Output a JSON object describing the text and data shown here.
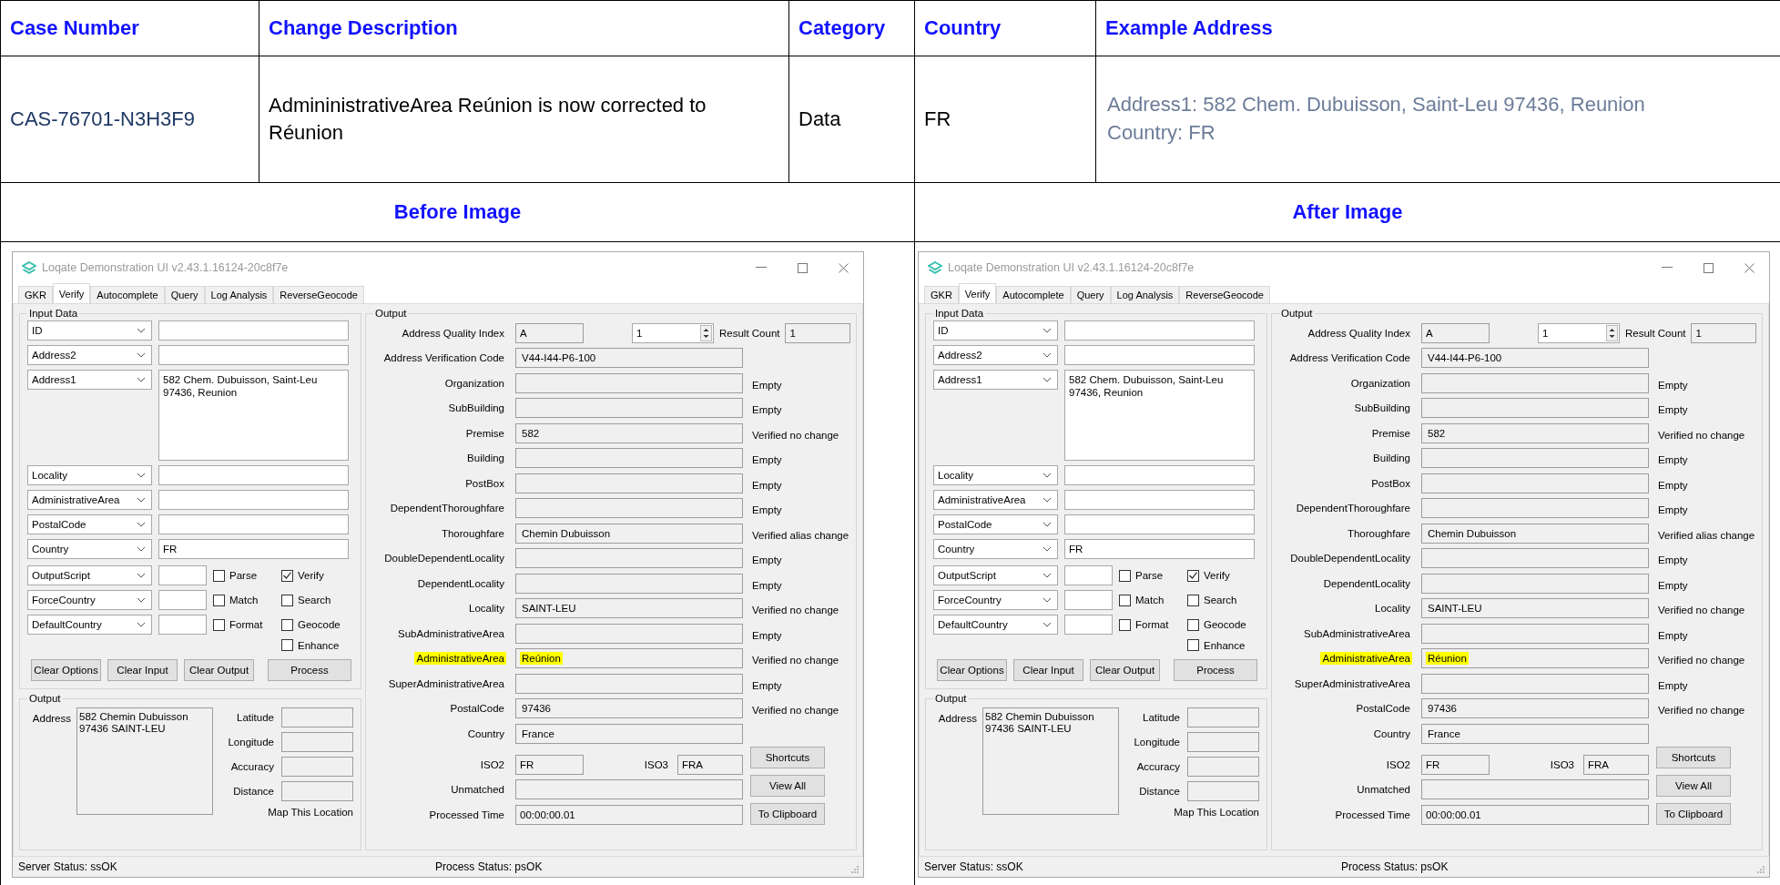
{
  "table": {
    "columns": [
      "Case Number",
      "Change Description",
      "Category",
      "Country",
      "Example Address"
    ],
    "row": {
      "case_number": "CAS-76701-N3H3F9",
      "change_description": "AdmininistrativeArea Reúnion is now corrected to Réunion",
      "category": "Data",
      "country": "FR",
      "example_address": [
        "Address1: 582 Chem. Dubuisson, Saint-Leu 97436, Reunion",
        "Country: FR"
      ]
    }
  },
  "comparison": [
    {
      "heading": "Before Image",
      "window": {
        "title": "Loqate Demonstration UI v2.43.1.16124-20c8f7e",
        "tabs": [
          {
            "label": "GKR",
            "selected": false
          },
          {
            "label": "Verify",
            "selected": true
          },
          {
            "label": "Autocomplete",
            "selected": false
          },
          {
            "label": "Query",
            "selected": false
          },
          {
            "label": "Log Analysis",
            "selected": false
          },
          {
            "label": "ReverseGeocode",
            "selected": false
          }
        ],
        "input_data": {
          "title": "Input Data",
          "rows": [
            {
              "kind": "line",
              "combo": "ID"
            },
            {
              "kind": "line",
              "combo": "Address2"
            },
            {
              "kind": "area",
              "combo": "Address1",
              "value": "582 Chem. Dubuisson, Saint-Leu 97436, Reunion"
            },
            {
              "kind": "line",
              "combo": "Locality"
            },
            {
              "kind": "line",
              "combo": "AdministrativeArea"
            },
            {
              "kind": "line",
              "combo": "PostalCode"
            },
            {
              "kind": "line",
              "combo": "Country",
              "value": "FR"
            }
          ],
          "option_combos": [
            "OutputScript",
            "ForceCountry",
            "DefaultCountry"
          ],
          "options": [
            [
              {
                "label": "Parse",
                "checked": false
              },
              {
                "label": "Match",
                "checked": false
              },
              {
                "label": "Format",
                "checked": false
              }
            ],
            [
              {
                "label": "Verify",
                "checked": true
              },
              {
                "label": "Search",
                "checked": false
              },
              {
                "label": "Geocode",
                "checked": false
              },
              {
                "label": "Enhance",
                "checked": false
              }
            ]
          ],
          "buttons": [
            "Clear Options",
            "Clear Input",
            "Clear Output",
            "Process"
          ]
        },
        "address_output": {
          "title": "Output",
          "address_label": "Address",
          "address_lines": [
            "582 Chemin Dubuisson",
            "97436 SAINT-LEU"
          ],
          "coords": [
            "Latitude",
            "Longitude",
            "Accuracy",
            "Distance"
          ],
          "link": "Map This Location"
        },
        "output": {
          "title": "Output",
          "quality": {
            "label": "Address Quality Index",
            "value": "A"
          },
          "spinner": "1",
          "result_count": {
            "label": "Result Count",
            "value": "1"
          },
          "rows": [
            {
              "label": "Address Verification Code",
              "value": "V44-I44-P6-100",
              "highlighted": false
            },
            {
              "label": "Organization",
              "status": "Empty",
              "highlighted": false
            },
            {
              "label": "SubBuilding",
              "status": "Empty",
              "highlighted": false
            },
            {
              "label": "Premise",
              "value": "582",
              "status": "Verified no change",
              "highlighted": false
            },
            {
              "label": "Building",
              "status": "Empty",
              "highlighted": false
            },
            {
              "label": "PostBox",
              "status": "Empty",
              "highlighted": false
            },
            {
              "label": "DependentThoroughfare",
              "status": "Empty",
              "highlighted": false
            },
            {
              "label": "Thoroughfare",
              "value": "Chemin Dubuisson",
              "status": "Verified alias change",
              "highlighted": false
            },
            {
              "label": "DoubleDependentLocality",
              "status": "Empty",
              "highlighted": false
            },
            {
              "label": "DependentLocality",
              "status": "Empty",
              "highlighted": false
            },
            {
              "label": "Locality",
              "value": "SAINT-LEU",
              "status": "Verified no change",
              "highlighted": false
            },
            {
              "label": "SubAdministrativeArea",
              "status": "Empty",
              "highlighted": false
            },
            {
              "label": "AdministrativeArea",
              "value": "Reúnion",
              "status": "Verified no change",
              "highlighted": true
            },
            {
              "label": "SuperAdministrativeArea",
              "status": "Empty",
              "highlighted": false
            },
            {
              "label": "PostalCode",
              "value": "97436",
              "status": "Verified no change",
              "highlighted": false
            },
            {
              "label": "Country",
              "value": "France",
              "highlighted": false
            }
          ],
          "iso2": {
            "label": "ISO2",
            "value": "FR"
          },
          "iso3": {
            "label": "ISO3",
            "value": "FRA"
          },
          "unmatched": {
            "label": "Unmatched"
          },
          "processed": {
            "label": "Processed Time",
            "value": "00:00:00.01"
          },
          "buttons": [
            "Shortcuts",
            "View All",
            "To Clipboard"
          ]
        },
        "status_bar": [
          "Server Status: ssOK",
          "Process Status: psOK"
        ]
      }
    },
    {
      "heading": "After Image",
      "window": {
        "title": "Loqate Demonstration UI v2.43.1.16124-20c8f7e",
        "tabs": [
          {
            "label": "GKR",
            "selected": false
          },
          {
            "label": "Verify",
            "selected": true
          },
          {
            "label": "Autocomplete",
            "selected": false
          },
          {
            "label": "Query",
            "selected": false
          },
          {
            "label": "Log Analysis",
            "selected": false
          },
          {
            "label": "ReverseGeocode",
            "selected": false
          }
        ],
        "input_data": {
          "title": "Input Data",
          "rows": [
            {
              "kind": "line",
              "combo": "ID"
            },
            {
              "kind": "line",
              "combo": "Address2"
            },
            {
              "kind": "area",
              "combo": "Address1",
              "value": "582 Chem. Dubuisson, Saint-Leu 97436, Reunion"
            },
            {
              "kind": "line",
              "combo": "Locality"
            },
            {
              "kind": "line",
              "combo": "AdministrativeArea"
            },
            {
              "kind": "line",
              "combo": "PostalCode"
            },
            {
              "kind": "line",
              "combo": "Country",
              "value": "FR"
            }
          ],
          "option_combos": [
            "OutputScript",
            "ForceCountry",
            "DefaultCountry"
          ],
          "options": [
            [
              {
                "label": "Parse",
                "checked": false
              },
              {
                "label": "Match",
                "checked": false
              },
              {
                "label": "Format",
                "checked": false
              }
            ],
            [
              {
                "label": "Verify",
                "checked": true
              },
              {
                "label": "Search",
                "checked": false
              },
              {
                "label": "Geocode",
                "checked": false
              },
              {
                "label": "Enhance",
                "checked": false
              }
            ]
          ],
          "buttons": [
            "Clear Options",
            "Clear Input",
            "Clear Output",
            "Process"
          ]
        },
        "address_output": {
          "title": "Output",
          "address_label": "Address",
          "address_lines": [
            "582 Chemin Dubuisson",
            "97436 SAINT-LEU"
          ],
          "coords": [
            "Latitude",
            "Longitude",
            "Accuracy",
            "Distance"
          ],
          "link": "Map This Location"
        },
        "output": {
          "title": "Output",
          "quality": {
            "label": "Address Quality Index",
            "value": "A"
          },
          "spinner": "1",
          "result_count": {
            "label": "Result Count",
            "value": "1"
          },
          "rows": [
            {
              "label": "Address Verification Code",
              "value": "V44-I44-P6-100",
              "highlighted": false
            },
            {
              "label": "Organization",
              "status": "Empty",
              "highlighted": false
            },
            {
              "label": "SubBuilding",
              "status": "Empty",
              "highlighted": false
            },
            {
              "label": "Premise",
              "value": "582",
              "status": "Verified no change",
              "highlighted": false
            },
            {
              "label": "Building",
              "status": "Empty",
              "highlighted": false
            },
            {
              "label": "PostBox",
              "status": "Empty",
              "highlighted": false
            },
            {
              "label": "DependentThoroughfare",
              "status": "Empty",
              "highlighted": false
            },
            {
              "label": "Thoroughfare",
              "value": "Chemin Dubuisson",
              "status": "Verified alias change",
              "highlighted": false
            },
            {
              "label": "DoubleDependentLocality",
              "status": "Empty",
              "highlighted": false
            },
            {
              "label": "DependentLocality",
              "status": "Empty",
              "highlighted": false
            },
            {
              "label": "Locality",
              "value": "SAINT-LEU",
              "status": "Verified no change",
              "highlighted": false
            },
            {
              "label": "SubAdministrativeArea",
              "status": "Empty",
              "highlighted": false
            },
            {
              "label": "AdministrativeArea",
              "value": "Réunion",
              "status": "Verified no change",
              "highlighted": true
            },
            {
              "label": "SuperAdministrativeArea",
              "status": "Empty",
              "highlighted": false
            },
            {
              "label": "PostalCode",
              "value": "97436",
              "status": "Verified no change",
              "highlighted": false
            },
            {
              "label": "Country",
              "value": "France",
              "highlighted": false
            }
          ],
          "iso2": {
            "label": "ISO2",
            "value": "FR"
          },
          "iso3": {
            "label": "ISO3",
            "value": "FRA"
          },
          "unmatched": {
            "label": "Unmatched"
          },
          "processed": {
            "label": "Processed Time",
            "value": "00:00:00.01"
          },
          "buttons": [
            "Shortcuts",
            "View All",
            "To Clipboard"
          ]
        },
        "status_bar": [
          "Server Status: ssOK",
          "Process Status: psOK"
        ]
      }
    }
  ]
}
